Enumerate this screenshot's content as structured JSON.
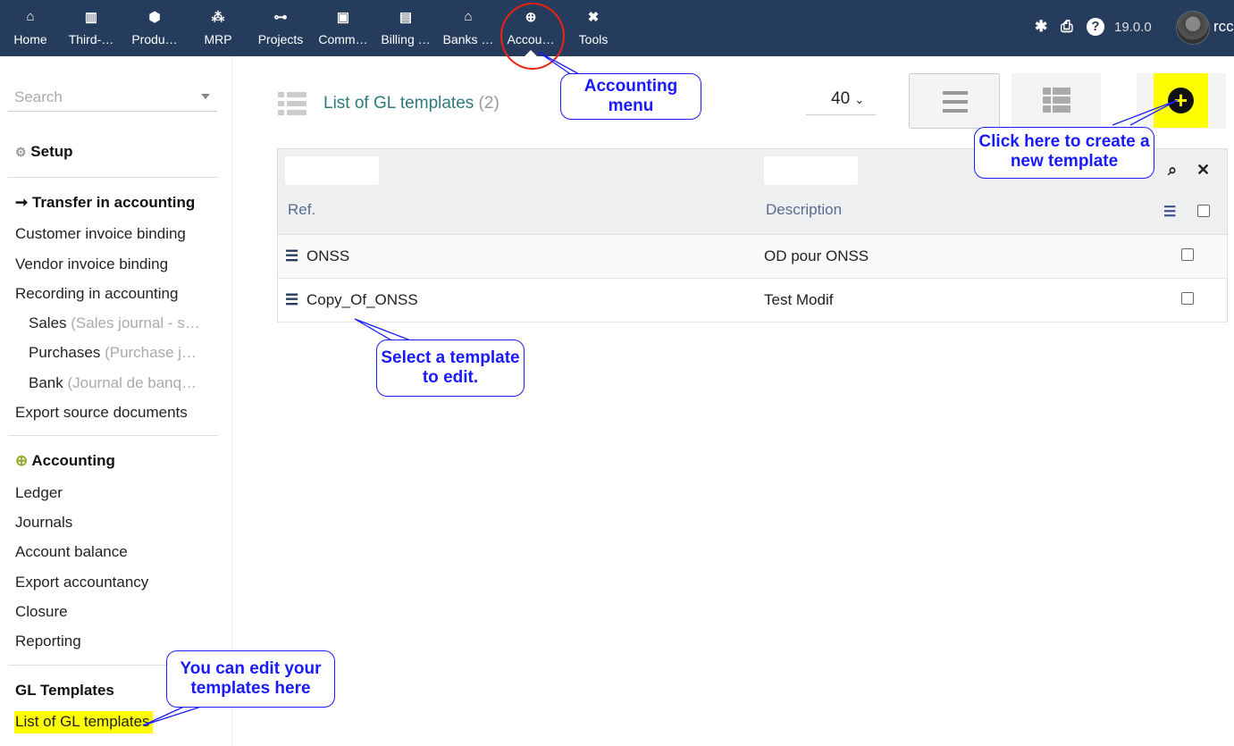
{
  "topnav": [
    {
      "label": "Home",
      "icon": "home-icon"
    },
    {
      "label": "Third-…",
      "icon": "building-icon"
    },
    {
      "label": "Produ…",
      "icon": "cube-icon"
    },
    {
      "label": "MRP",
      "icon": "cubes-icon"
    },
    {
      "label": "Projects",
      "icon": "project-diagram-icon"
    },
    {
      "label": "Comm…",
      "icon": "briefcase-icon"
    },
    {
      "label": "Billing …",
      "icon": "invoice-icon"
    },
    {
      "label": "Banks …",
      "icon": "bank-icon"
    },
    {
      "label": "Accou…",
      "icon": "search-dollar-icon"
    },
    {
      "label": "Tools",
      "icon": "tools-icon"
    }
  ],
  "header": {
    "version": "19.0.0",
    "user": "rcc"
  },
  "sidebar": {
    "search_placeholder": "Search",
    "setup": "Setup",
    "transfer": "Transfer in accounting",
    "transfer_items": [
      "Customer invoice binding",
      "Vendor invoice binding",
      "Recording in accounting"
    ],
    "journals": [
      {
        "name": "Sales",
        "detail": "(Sales journal - s…"
      },
      {
        "name": "Purchases",
        "detail": "(Purchase j…"
      },
      {
        "name": "Bank",
        "detail": "(Journal de banq…"
      }
    ],
    "export_source": "Export source documents",
    "accounting": "Accounting",
    "accounting_items": [
      "Ledger",
      "Journals",
      "Account balance",
      "Export accountancy",
      "Closure",
      "Reporting"
    ],
    "gl": "GL Templates",
    "gl_list": "List of GL templates"
  },
  "main": {
    "title": "List of GL templates",
    "count": "(2)",
    "page_size": "40",
    "columns": [
      "Ref.",
      "Description"
    ],
    "rows": [
      {
        "ref": "ONSS",
        "desc": "OD pour ONSS"
      },
      {
        "ref": "Copy_Of_ONSS",
        "desc": "Test Modif"
      }
    ]
  },
  "callouts": {
    "menu": "Accounting menu",
    "create": "Click here to create a new template",
    "select": "Select a template to edit.",
    "edit": "You can edit your templates here"
  },
  "colors": {
    "topbar": "#263c5c",
    "accent": "#2c7a7b",
    "highlight": "#ffff00",
    "callout": "#1a1aff"
  }
}
